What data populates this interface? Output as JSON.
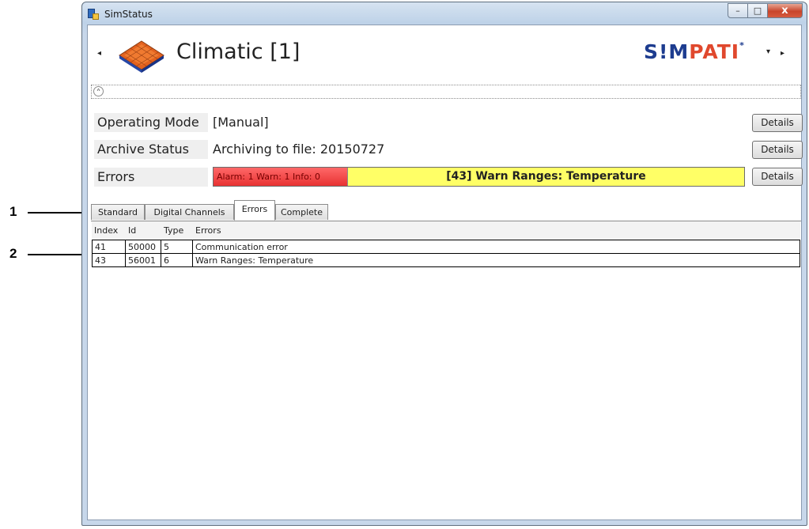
{
  "window": {
    "title": "SimStatus",
    "controls": {
      "minimize": "–",
      "maximize": "□",
      "close": "x"
    }
  },
  "header": {
    "title": "Climatic [1]",
    "nav_back": "◂",
    "nav_forward": "▸",
    "nav_dropdown": "▾",
    "brand": {
      "part1": "S!M",
      "part2": "PATI",
      "mark": "*"
    }
  },
  "collapse": {
    "icon": "^"
  },
  "info": {
    "operating_mode": {
      "label": "Operating Mode",
      "value": "[Manual]",
      "button": "Details"
    },
    "archive_status": {
      "label": "Archive Status",
      "value": "Archiving to file: 20150727",
      "button": "Details"
    },
    "errors": {
      "label": "Errors",
      "counts": "Alarm: 1  Warn: 1  Info: 0",
      "message": "[43] Warn Ranges: Temperature",
      "button": "Details"
    }
  },
  "tabs": [
    "Standard",
    "Digital Channels",
    "Errors",
    "Complete"
  ],
  "active_tab": "Errors",
  "table": {
    "columns": [
      "Index",
      "Id",
      "Type",
      "Errors"
    ],
    "rows": [
      [
        "41",
        "50000",
        "5",
        "Communication error"
      ],
      [
        "43",
        "56001",
        "6",
        "Warn Ranges: Temperature"
      ]
    ]
  },
  "callouts": [
    "1",
    "2"
  ],
  "colors": {
    "alarm_red": "#e83232",
    "warn_yellow": "#ffff66",
    "brand_blue": "#1d3c8f",
    "brand_orange": "#e0482d"
  }
}
